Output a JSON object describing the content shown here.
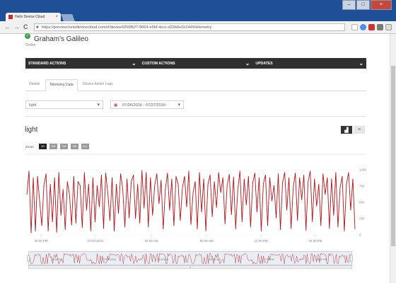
{
  "browser": {
    "tab_title": "Helix Device Cloud",
    "tab_close": "×",
    "nav_back": "←",
    "nav_forward": "→",
    "nav_reload": "C",
    "url": "https://preview.helixdevicecloud.com/#/device4250fb27-9064-e5bf-4ccc-d22b0e1b2445/telemetry",
    "window_buttons": {
      "min": "–",
      "max": "□",
      "close": "×"
    }
  },
  "device": {
    "name": "Graham's Galileo",
    "status": "Online"
  },
  "actions": [
    {
      "label": "STANDARD ACTIONS"
    },
    {
      "label": "CUSTOM ACTIONS"
    },
    {
      "label": "UPDATES"
    }
  ],
  "tabs": [
    {
      "label": "Details",
      "active": false
    },
    {
      "label": "Telemetry Data",
      "active": true
    },
    {
      "label": "Device Action Logs",
      "active": false
    }
  ],
  "filters": {
    "metric": "light",
    "date_range": "07/26/2016 - 07/27/2016",
    "chevron": "▾"
  },
  "chart_header": {
    "title": "light",
    "zoom_label": "Zoom",
    "zoom_buttons": [
      {
        "label": "1D",
        "active": true
      },
      {
        "label": "3W",
        "active": false
      },
      {
        "label": "1M",
        "active": false
      },
      {
        "label": "3M",
        "active": false
      },
      {
        "label": "ALL",
        "active": false
      }
    ],
    "view_buttons": {
      "chart": "chart-icon",
      "table": "list-icon"
    }
  },
  "chart_data": {
    "type": "line",
    "title": "light",
    "ylim": [
      0,
      1000
    ],
    "yticks": [
      0,
      250,
      500,
      750,
      1000
    ],
    "x_tick_labels": [
      "08:00 PM",
      "07/27/2016",
      "04:00 AM",
      "08:00 AM",
      "12:00 PM",
      "04:00 PM"
    ],
    "series": [
      {
        "color": "#b0141a",
        "values": [
          620,
          980,
          30,
          880,
          60,
          900,
          520,
          140,
          760,
          940,
          60,
          780,
          200,
          880,
          40,
          960,
          300,
          700,
          80,
          820,
          620,
          150,
          900,
          180,
          820,
          760,
          110,
          960,
          380,
          780,
          60,
          880,
          200,
          760,
          430,
          920,
          100,
          950,
          640,
          220,
          880,
          60,
          780,
          330,
          940,
          700,
          120,
          860,
          260,
          820,
          920,
          250,
          780,
          180,
          990,
          410,
          960,
          120,
          880,
          300,
          760,
          940,
          480,
          840,
          90,
          700,
          950,
          380,
          860,
          140,
          900,
          780,
          220,
          720,
          900,
          430,
          980,
          160,
          640,
          820,
          90,
          960,
          350,
          860,
          60,
          780,
          920,
          280,
          820,
          420,
          960,
          650,
          880,
          170,
          760,
          930,
          310,
          890,
          90,
          700,
          980,
          200,
          860,
          460,
          900,
          120,
          800,
          950,
          350,
          880,
          60,
          790,
          920,
          140,
          880,
          520,
          760,
          260,
          940,
          80,
          800,
          960,
          380,
          880,
          100,
          720,
          950,
          220,
          880,
          540,
          920,
          70,
          820,
          980,
          200,
          860,
          440,
          780,
          140,
          940,
          620,
          880,
          100,
          860,
          300,
          960,
          120,
          720,
          900,
          60,
          780,
          960,
          380,
          860,
          90
        ]
      }
    ],
    "navigator": {
      "x_tick_labels": [
        "08:00 PM",
        "07/27/2016",
        "04:00 AM",
        "08:00 AM",
        "12:00 PM",
        "04:00 PM"
      ],
      "scroll_glyph": "≡"
    }
  },
  "colors": {
    "line": "#b0141a",
    "action_bar": "#303030",
    "titlebar": "#1f4f97"
  }
}
